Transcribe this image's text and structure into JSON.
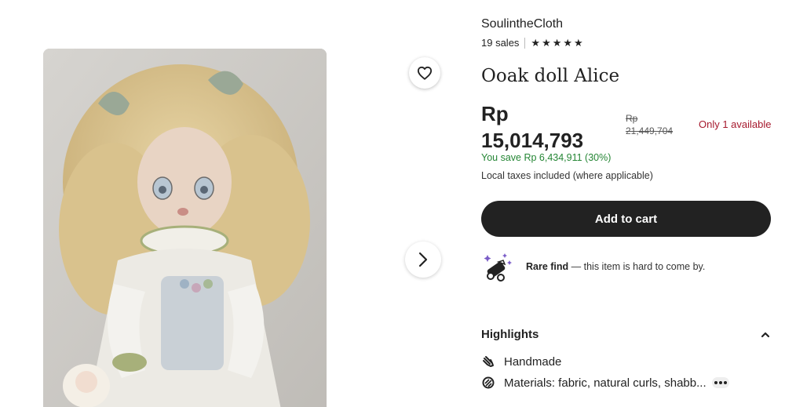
{
  "shop": {
    "name": "SoulintheCloth",
    "sales": "19 sales",
    "rating_stars": 5
  },
  "listing": {
    "title": "Ooak doll Alice",
    "price_currency": "Rp",
    "price_value": "15,014,793",
    "old_price_currency": "Rp",
    "old_price_value": "21,449,704",
    "stock": "Only 1 available",
    "savings": "You save Rp 6,434,911 (30%)",
    "taxes": "Local taxes included (where applicable)"
  },
  "actions": {
    "add_to_cart": "Add to cart"
  },
  "rare": {
    "bold": "Rare find",
    "rest": " — this item is hard to come by."
  },
  "highlights": {
    "heading": "Highlights",
    "items": [
      {
        "icon": "hand-icon",
        "label": "Handmade"
      },
      {
        "icon": "materials-icon",
        "label": "Materials: fabric, natural curls, shabb..."
      }
    ]
  },
  "colors": {
    "savings_green": "#258635",
    "stock_red": "#a61a2e",
    "button_dark": "#222222"
  }
}
